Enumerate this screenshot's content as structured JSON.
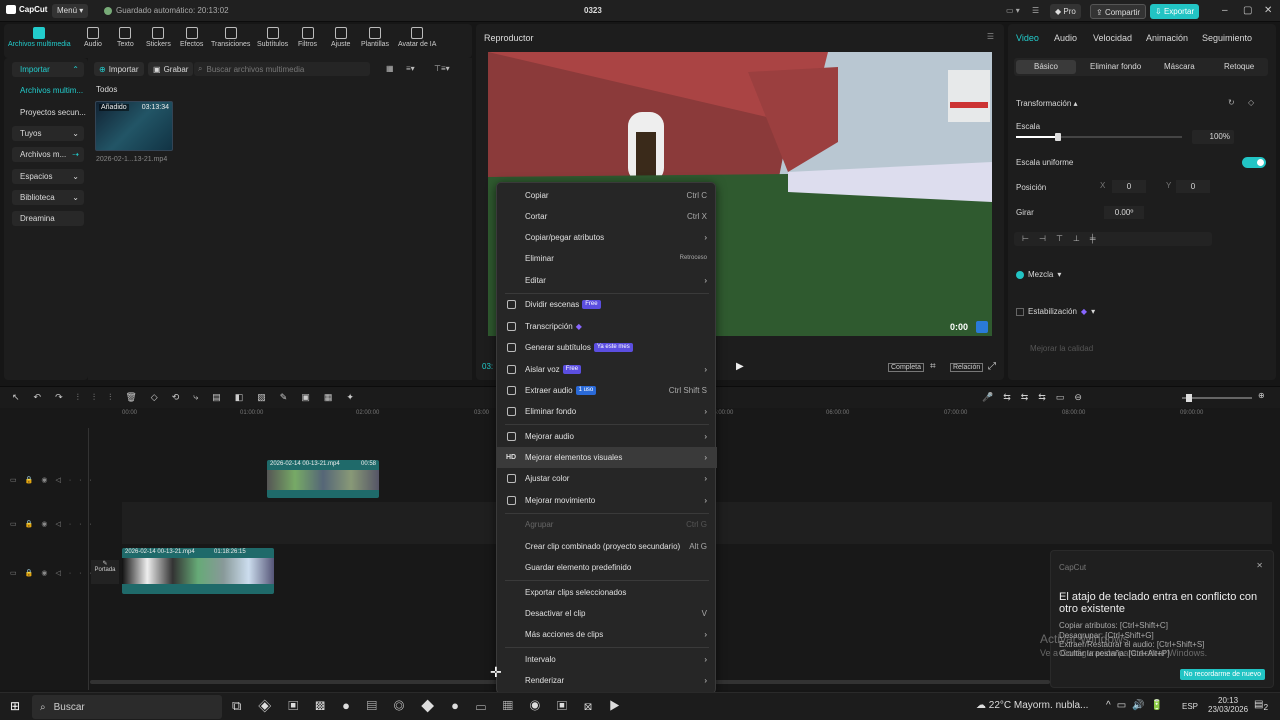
{
  "app": {
    "logo": "CapCut",
    "menu": "Menú",
    "autosave": "Guardado automático: 20:13:02",
    "project": "0323",
    "pro": "Pro",
    "share": "Compartir",
    "export": "Exportar"
  },
  "toolbar": {
    "items": [
      "Archivos multimedia",
      "Audio",
      "Texto",
      "Stickers",
      "Efectos",
      "Transiciones",
      "Subtítulos",
      "Filtros",
      "Ajuste",
      "Plantillas",
      "Avatar de IA"
    ]
  },
  "leftnav": {
    "import": "Importar",
    "items": [
      "Archivos multim...",
      "Proyectos secun...",
      "Tuyos",
      "Archivos m...",
      "Espacios",
      "Biblioteca",
      "Dreamina"
    ]
  },
  "media": {
    "import_btn": "Importar",
    "record_btn": "Grabar",
    "search_placeholder": "Buscar archivos multimedia",
    "all": "Todos",
    "thumb_tag": "Añadido",
    "thumb_time": "03:13:34",
    "thumb_name": "2026-02-1...13-21.mp4"
  },
  "player": {
    "title": "Reproductor",
    "time": "0:00",
    "completa": "Completa",
    "relacion": "Relación",
    "timecode": "03:"
  },
  "right": {
    "tabs": [
      "Video",
      "Audio",
      "Velocidad",
      "Animación",
      "Seguimiento"
    ],
    "subtabs": [
      "Básico",
      "Eliminar fondo",
      "Máscara",
      "Retoque"
    ],
    "transform": "Transformación",
    "scale": "Escala",
    "scale_val": "100%",
    "uniform": "Escala uniforme",
    "position": "Posición",
    "pos_x_label": "X",
    "pos_x": "0",
    "pos_y_label": "Y",
    "pos_y": "0",
    "rotate": "Girar",
    "rotate_val": "0.00º",
    "blend": "Mezcla",
    "stabilize": "Estabilización",
    "improve": "Mejorar la calidad",
    "scale_fraction": 0.25
  },
  "timeline": {
    "ticks": [
      "00:00",
      "01:00:00",
      "02:00:00",
      "03:00",
      "05:00:00",
      "06:00:00",
      "07:00:00",
      "08:00:00",
      "09:00:00"
    ],
    "clip1": "2026-02-14 00-13-21.mp4",
    "clip1_dur": "00:58",
    "clip2": "2026-02-14 00-13-21.mp4",
    "clip2_dur": "01:18:26:15",
    "cover": "Portada"
  },
  "context_menu": {
    "items": [
      {
        "label": "Copiar",
        "sc": "Ctrl C"
      },
      {
        "label": "Cortar",
        "sc": "Ctrl X"
      },
      {
        "label": "Copiar/pegar atributos",
        "sc": "›"
      },
      {
        "label": "Eliminar",
        "sc": "Retroceso"
      },
      {
        "label": "Editar",
        "sc": "›"
      },
      {
        "label": "Dividir escenas",
        "badge": "Free"
      },
      {
        "label": "Transcripción",
        "badge": "◆"
      },
      {
        "label": "Generar subtítulos",
        "badge": "Ya este mes"
      },
      {
        "label": "Aislar voz",
        "badge": "Free",
        "sc": "›"
      },
      {
        "label": "Extraer audio",
        "badge": "1 uso",
        "sc": "Ctrl Shift S"
      },
      {
        "label": "Eliminar fondo",
        "sc": "›"
      },
      {
        "label": "Mejorar audio",
        "sc": "›"
      },
      {
        "label": "Mejorar elementos visuales",
        "sc": "›",
        "icon": "HD"
      },
      {
        "label": "Ajustar color",
        "sc": "›"
      },
      {
        "label": "Mejorar movimiento",
        "sc": "›"
      },
      {
        "label": "Agrupar",
        "sc": "Ctrl G"
      },
      {
        "label": "Crear clip combinado (proyecto secundario)",
        "sc": "Alt G"
      },
      {
        "label": "Guardar elemento predefinido"
      },
      {
        "label": "Exportar clips seleccionados"
      },
      {
        "label": "Desactivar el clip",
        "sc": "V"
      },
      {
        "label": "Más acciones de clips",
        "sc": "›"
      },
      {
        "label": "Intervalo",
        "sc": "›"
      },
      {
        "label": "Renderizar",
        "sc": "›"
      }
    ]
  },
  "toast": {
    "app": "CapCut",
    "title": "El atajo de teclado entra en conflicto con otro existente",
    "lines": [
      "Copiar atributos: [Ctrl+Shift+C]",
      "Desagrupar: [Ctrl+Shift+G]",
      "Extraer/Restaurar el audio: [Ctrl+Shift+S]",
      "Ocultar la pestaña: [Ctrl+Alt+P]"
    ],
    "button": "No recordarme de nuevo",
    "watermark1": "Activar Windows",
    "watermark2": "Ve a Configuración para activar Windows."
  },
  "taskbar": {
    "search": "Buscar",
    "weather": "22°C  Mayorm. nubla...",
    "lang": "ESP",
    "time": "20:13",
    "date": "23/03/2026",
    "notif": "2"
  },
  "colors": {
    "accent": "#22c4c4",
    "purple": "#5b4ee0"
  }
}
